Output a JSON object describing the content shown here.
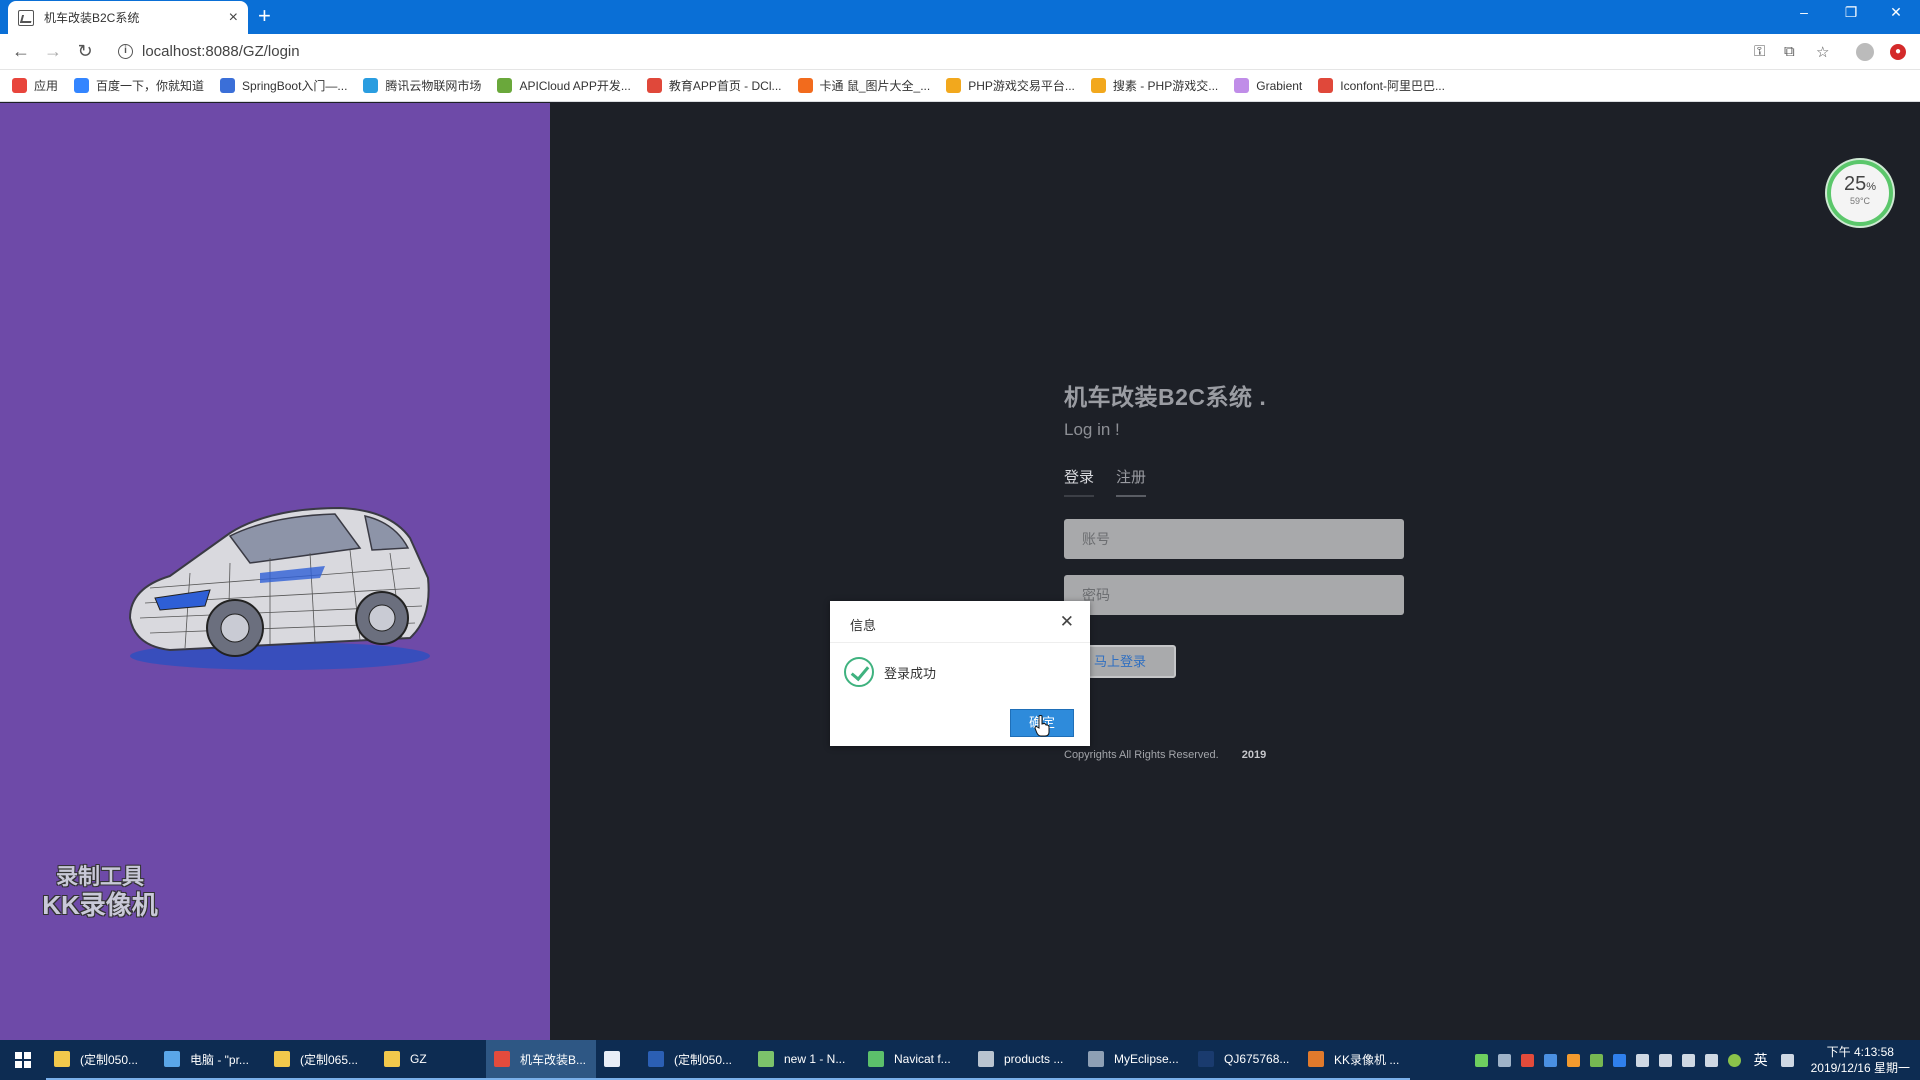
{
  "browser": {
    "tab_title": "机车改装B2C系统",
    "tab_close": "×",
    "new_tab": "+",
    "url": "localhost:8088/GZ/login",
    "window_controls": {
      "minimize": "–",
      "restore": "❐",
      "close": "✕"
    }
  },
  "bookmarks": [
    {
      "label": "应用",
      "icon": "apps-icon",
      "color": "#e8453c"
    },
    {
      "label": "百度一下，你就知道",
      "icon": "baidu-icon",
      "color": "#3385ff"
    },
    {
      "label": "SpringBoot入门—...",
      "icon": "springboot-icon",
      "color": "#3b6fd8"
    },
    {
      "label": "腾讯云物联网市场",
      "icon": "cloud-icon",
      "color": "#2a9de0"
    },
    {
      "label": "APICloud APP开发...",
      "icon": "apicloud-icon",
      "color": "#6aa83b"
    },
    {
      "label": "教育APP首页 - DCl...",
      "icon": "dcloud-icon",
      "color": "#e0483a"
    },
    {
      "label": "卡通 鼠_图片大全_...",
      "icon": "image-icon",
      "color": "#f26b1d"
    },
    {
      "label": "PHP游戏交易平台...",
      "icon": "php-icon",
      "color": "#f2a81d"
    },
    {
      "label": "搜素 - PHP游戏交...",
      "icon": "php-search-icon",
      "color": "#f2a81d"
    },
    {
      "label": "Grabient",
      "icon": "grabient-icon",
      "color": "#c08de8"
    },
    {
      "label": "Iconfont-阿里巴巴...",
      "icon": "iconfont-icon",
      "color": "#e0483a"
    }
  ],
  "cpu_widget": {
    "percent": "25",
    "percent_sign": "%",
    "temp": "59°C"
  },
  "watermark": {
    "line1": "录制工具",
    "line2": "KK录像机"
  },
  "login": {
    "title": "机车改装B2C系统 .",
    "subtitle": "Log in !",
    "tabs": [
      "登录",
      "注册"
    ],
    "account_placeholder": "账号",
    "password_placeholder": "密码",
    "submit": "马上登录",
    "footer_text": "Copyrights All Rights Reserved.",
    "footer_year": "2019"
  },
  "dialog": {
    "title": "信息",
    "close": "✕",
    "message": "登录成功",
    "ok": "确定"
  },
  "taskbar": {
    "items": [
      {
        "label": "(定制050...",
        "icon": "folder-icon",
        "color": "#f2c94c",
        "state": "running"
      },
      {
        "label": "电脑 - \"pr...",
        "icon": "computer-icon",
        "color": "#5aa6e8",
        "state": "running"
      },
      {
        "label": "(定制065...",
        "icon": "folder-icon",
        "color": "#f2c94c",
        "state": "running"
      },
      {
        "label": "GZ",
        "icon": "folder-icon",
        "color": "#f2c94c",
        "state": "running"
      },
      {
        "label": "机车改装B...",
        "icon": "chrome-icon",
        "color": "#e34b3d",
        "state": "active"
      },
      {
        "label": "",
        "icon": "app-icon",
        "color": "#e8eef7",
        "state": "running"
      },
      {
        "label": "(定制050...",
        "icon": "word-icon",
        "color": "#2b5fb4",
        "state": "running"
      },
      {
        "label": "new 1 - N...",
        "icon": "notepad-icon",
        "color": "#7cc36b",
        "state": "running"
      },
      {
        "label": "Navicat f...",
        "icon": "navicat-icon",
        "color": "#5cc06b",
        "state": "running"
      },
      {
        "label": "products ...",
        "icon": "database-icon",
        "color": "#b9c4d0",
        "state": "running"
      },
      {
        "label": "MyEclipse...",
        "icon": "eclipse-icon",
        "color": "#8ea0b5",
        "state": "running"
      },
      {
        "label": "QJ675768...",
        "icon": "photoshop-icon",
        "color": "#1a3b6e",
        "state": "running"
      },
      {
        "label": "KK录像机 ...",
        "icon": "kk-recorder-icon",
        "color": "#e07a2c",
        "state": "running"
      }
    ],
    "ime": "英",
    "clock_time": "下午 4:13:58",
    "clock_date": "2019/12/16 星期一"
  }
}
